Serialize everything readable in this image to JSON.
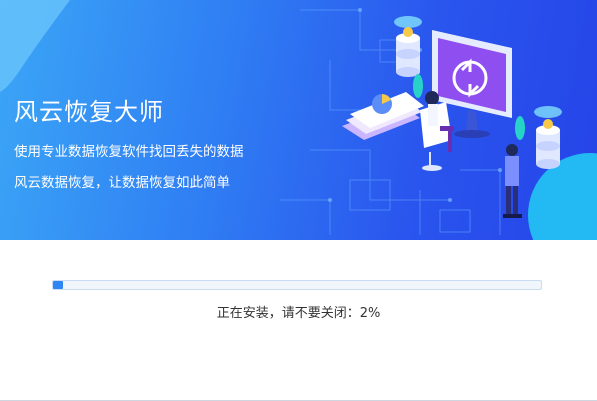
{
  "banner": {
    "title": "风云恢复大师",
    "subtitle_1": "使用专业数据恢复软件找回丢失的数据",
    "subtitle_2": "风云数据恢复，让数据恢复如此简单",
    "illustration": "data-recovery-illustration"
  },
  "install": {
    "progress": 0.02,
    "status_text": "正在安装，请不要关闭：2%"
  },
  "colors": {
    "accent": "#2e86f4",
    "banner_start": "#3ba6f6",
    "banner_end": "#2544e8"
  }
}
